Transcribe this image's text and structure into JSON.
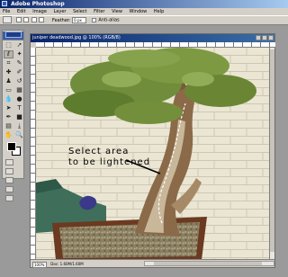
{
  "app": {
    "title": "Adobe Photoshop"
  },
  "menubar": [
    "File",
    "Edit",
    "Image",
    "Layer",
    "Select",
    "Filter",
    "View",
    "Window",
    "Help"
  ],
  "options": {
    "feather_label": "Feather:",
    "feather_value": "0 px",
    "antialias_label": "Anti-alias"
  },
  "document": {
    "title": "juniper deadwood.jpg @ 100% (RGB/8)"
  },
  "annotation": {
    "line1": "Select area",
    "line2": "to be lightened"
  },
  "status": {
    "zoom": "100%",
    "doc_info": "Doc: 1.60M/1.60M"
  },
  "colors": {
    "foreground": "#000000",
    "background": "#ffffff",
    "selection": "#ffffff"
  }
}
